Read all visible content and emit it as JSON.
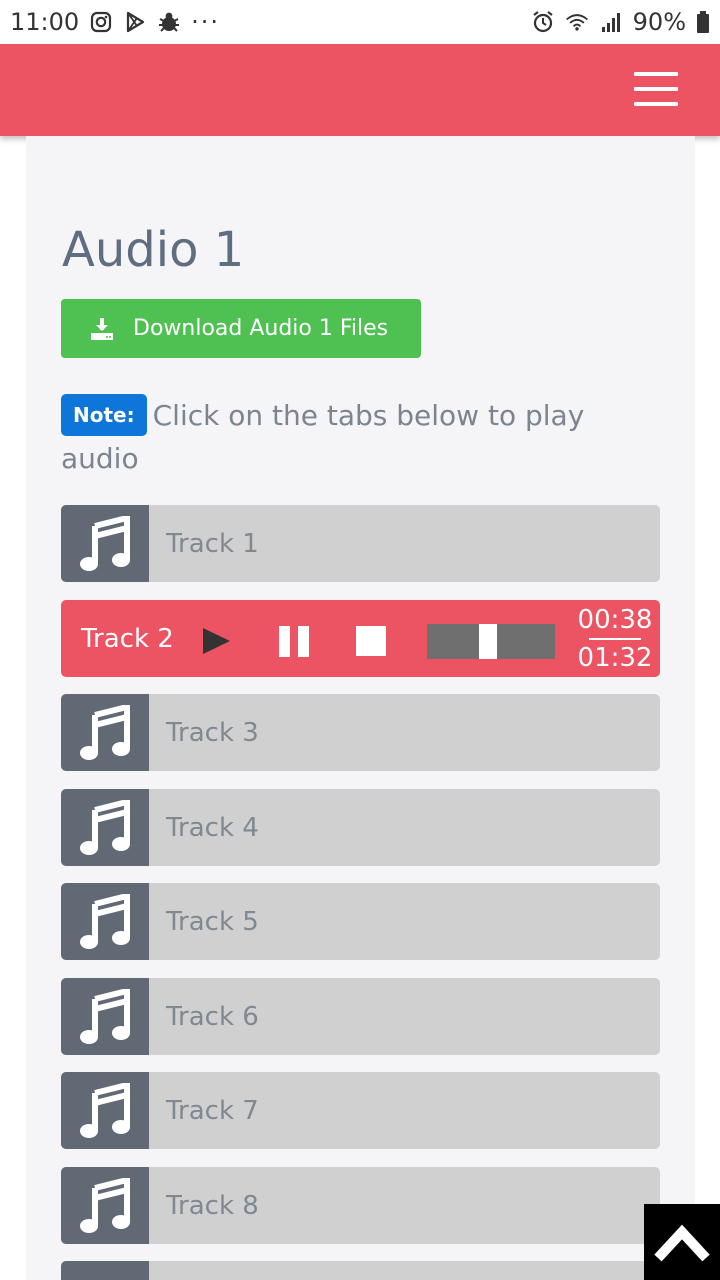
{
  "status_bar": {
    "time": "11:00",
    "more": "···",
    "battery": "90%"
  },
  "page": {
    "title": "Audio 1"
  },
  "download": {
    "label": "Download Audio 1 Files"
  },
  "note": {
    "badge": "Note:",
    "text": "Click on the tabs below to play audio"
  },
  "active_track": {
    "label": "Track 2",
    "current_time": "00:38",
    "duration": "01:32",
    "progress": 0.41
  },
  "tracks": [
    {
      "label": "Track 1"
    },
    {
      "label": "Track 3"
    },
    {
      "label": "Track 4"
    },
    {
      "label": "Track 5"
    },
    {
      "label": "Track 6"
    },
    {
      "label": "Track 7"
    },
    {
      "label": "Track 8"
    },
    {
      "label": ""
    }
  ],
  "colors": {
    "brand": "#ec5363",
    "download": "#4fc153",
    "note": "#0e75d9",
    "track_icon_bg": "#616975"
  }
}
